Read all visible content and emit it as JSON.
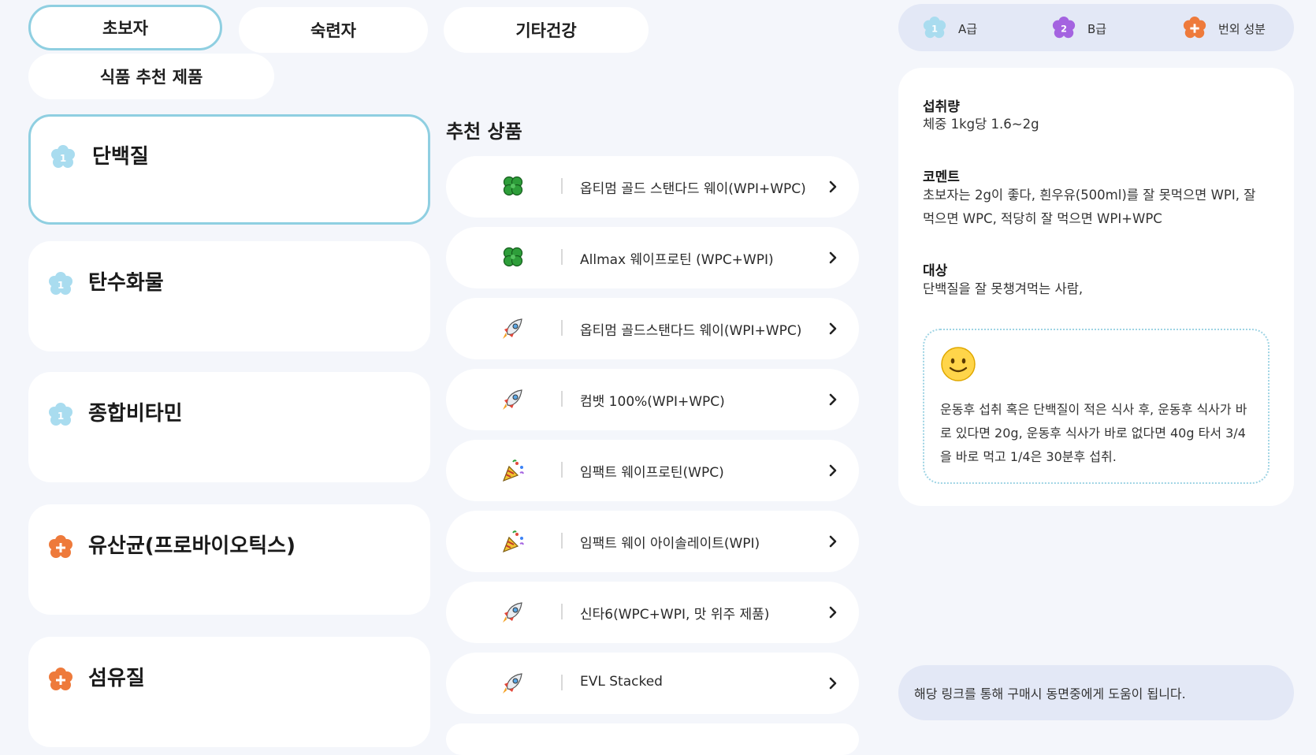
{
  "tabs": [
    {
      "label": "초보자",
      "active": true
    },
    {
      "label": "숙련자",
      "active": false
    },
    {
      "label": "기타건강",
      "active": false
    },
    {
      "label": "식품 추천 제품",
      "active": false
    }
  ],
  "categories": [
    {
      "label": "단백질",
      "badge": "1",
      "grade": "A",
      "active": true
    },
    {
      "label": "탄수화물",
      "badge": "1",
      "grade": "A",
      "active": false
    },
    {
      "label": "종합비타민",
      "badge": "1",
      "grade": "A",
      "active": false
    },
    {
      "label": "유산균(프로바이오틱스)",
      "badge": "+",
      "grade": "extra",
      "active": false
    },
    {
      "label": "섬유질",
      "badge": "+",
      "grade": "extra",
      "active": false
    }
  ],
  "products_section": {
    "title": "추천 상품",
    "items": [
      {
        "label": "옵티멈 골드 스탠다드 웨이(WPI+WPC)",
        "icon": "clover-icon"
      },
      {
        "label": "Allmax 웨이프로틴 (WPC+WPI)",
        "icon": "clover-icon"
      },
      {
        "label": "옵티멈 골드스탠다드 웨이(WPI+WPC)",
        "icon": "rocket-icon"
      },
      {
        "label": "컴뱃 100%(WPI+WPC)",
        "icon": "rocket-icon"
      },
      {
        "label": "임팩트 웨이프로틴(WPC)",
        "icon": "party-popper-icon"
      },
      {
        "label": "임팩트 웨이 아이솔레이트(WPI)",
        "icon": "party-popper-icon"
      },
      {
        "label": "신타6(WPC+WPI, 맛 위주 제품)",
        "icon": "rocket-icon"
      },
      {
        "label": "EVL Stacked",
        "icon": "rocket-icon"
      }
    ]
  },
  "legend": [
    {
      "badge": "1",
      "label": "A급",
      "color": "#a9dcef"
    },
    {
      "badge": "2",
      "label": "B급",
      "color": "#a463e0"
    },
    {
      "badge": "+",
      "label": "번외 성분",
      "color": "#ee7a3b"
    }
  ],
  "detail": {
    "intake_heading": "섭취량",
    "intake_text": "체중 1kg당 1.6~2g",
    "comment_heading": "코멘트",
    "comment_text": "초보자는 2g이 좋다, 흰우유(500ml)를 잘 못먹으면 WPI, 잘 먹으면 WPC, 적당히 잘 먹으면 WPI+WPC",
    "target_heading": "대상",
    "target_text": "단백질을 잘 못챙겨먹는 사람,",
    "tip_text": "운동후 섭취 혹은 단백질이 적은 식사 후, 운동후 식사가 바로 있다면 20g, 운동후 식사가 바로 없다면 40g 타서 3/4을 바로 먹고 1/4은 30분후 섭취."
  },
  "footer_note": "해당 링크를 통해 구매시 동면중에게 도움이 됩니다.",
  "colors": {
    "accent": "#8fcfe1",
    "background": "#f4f6fb",
    "badge_a": "#a9dcef",
    "badge_b": "#a463e0",
    "badge_extra": "#ee7a3b"
  }
}
